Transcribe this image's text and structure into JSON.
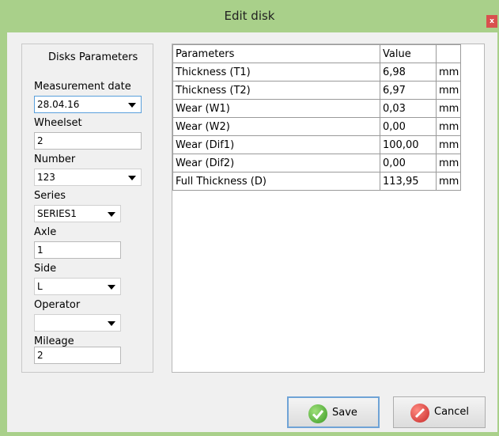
{
  "window": {
    "title": "Edit disk",
    "close_label": "x"
  },
  "left_panel": {
    "heading": "Disks Parameters",
    "measurement_date": {
      "label": "Measurement date",
      "value": "28.04.16"
    },
    "wheelset": {
      "label": "Wheelset",
      "value": "2"
    },
    "number": {
      "label": "Number",
      "value": "123"
    },
    "series": {
      "label": "Series",
      "value": "SERIES1"
    },
    "axle": {
      "label": "Axle",
      "value": "1"
    },
    "side": {
      "label": "Side",
      "value": "L"
    },
    "operator": {
      "label": "Operator",
      "value": ""
    },
    "mileage": {
      "label": "Mileage",
      "value": "2"
    }
  },
  "table": {
    "headers": [
      "Parameters",
      "Value",
      ""
    ],
    "rows": [
      [
        "Thickness (T1)",
        "6,98",
        "mm"
      ],
      [
        "Thickness (T2)",
        "6,97",
        "mm"
      ],
      [
        "Wear (W1)",
        "0,03",
        "mm"
      ],
      [
        "Wear (W2)",
        "0,00",
        "mm"
      ],
      [
        "Wear (Dif1)",
        "100,00",
        "mm"
      ],
      [
        "Wear (Dif2)",
        "0,00",
        "mm"
      ],
      [
        "Full Thickness (D)",
        "113,95",
        "mm"
      ]
    ]
  },
  "buttons": {
    "save_label": "Save",
    "cancel_label": "Cancel"
  },
  "icons": {
    "save": "check-circle-icon",
    "cancel": "no-entry-icon",
    "close": "close-icon",
    "dropdown": "chevron-down-icon"
  },
  "colors": {
    "titlebar": "#a9d08a",
    "close": "#d9504e",
    "focus_border": "#5aa0dc"
  }
}
